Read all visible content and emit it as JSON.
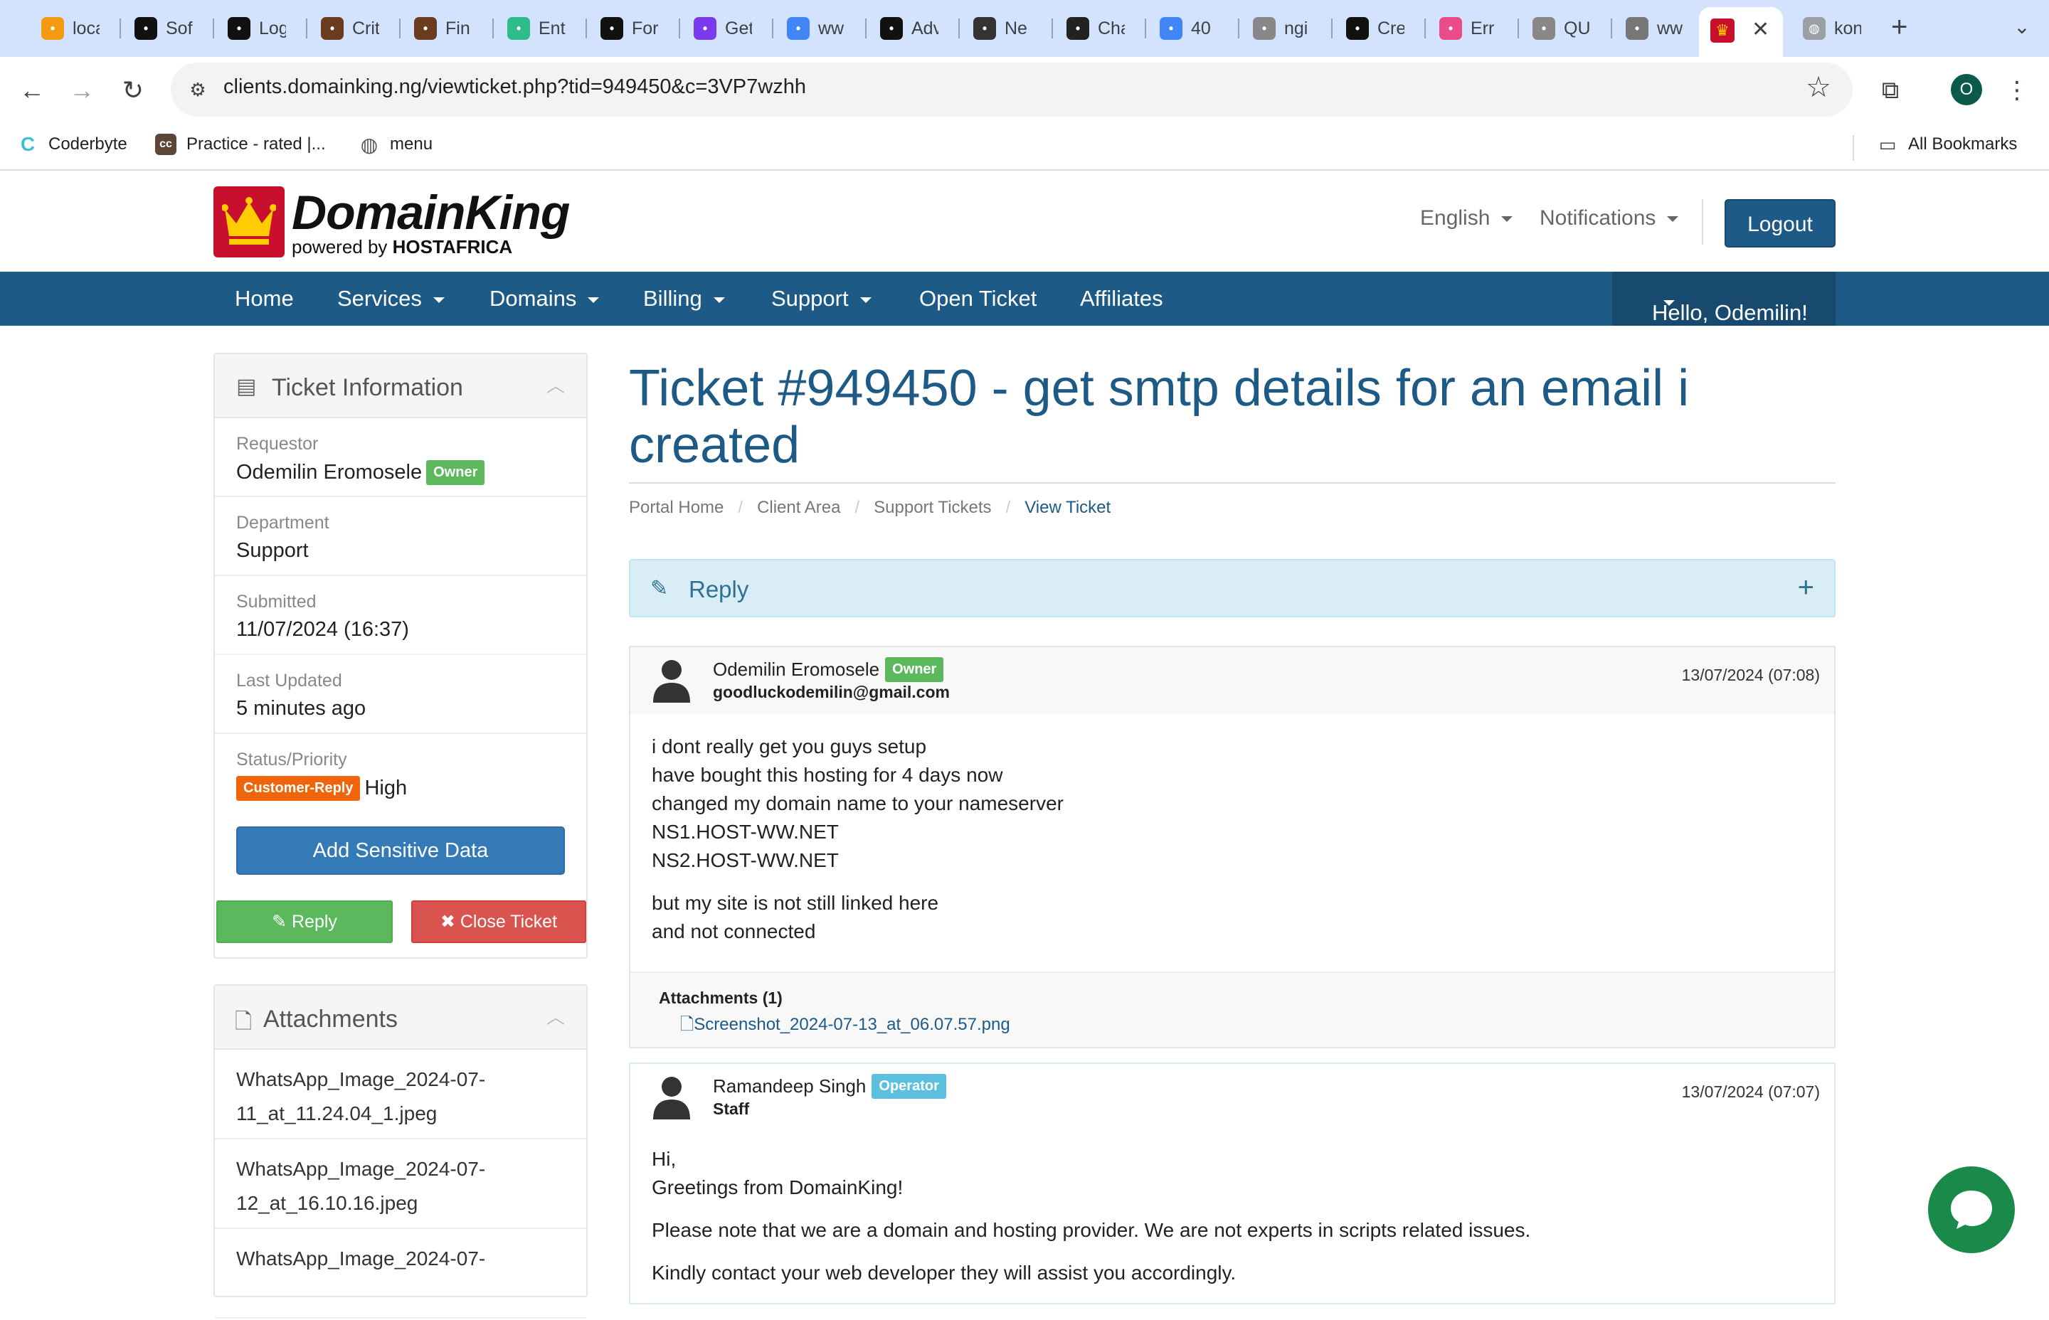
{
  "browser": {
    "tabs": [
      {
        "title": "loca",
        "icon": "pma-icon",
        "color": "#f39c12"
      },
      {
        "title": "Sof",
        "icon": "power-icon",
        "color": "#111111"
      },
      {
        "title": "Log",
        "icon": "power-icon",
        "color": "#111111"
      },
      {
        "title": "Crit",
        "icon": "book-icon",
        "color": "#6b3b1e"
      },
      {
        "title": "Fin",
        "icon": "book-icon",
        "color": "#6b3b1e"
      },
      {
        "title": "Ent",
        "icon": "vue-icon",
        "color": "#2ebc8a"
      },
      {
        "title": "For",
        "icon": "flag-icon",
        "color": "#111111"
      },
      {
        "title": "Get",
        "icon": "bootstrap-icon",
        "color": "#7c3aed"
      },
      {
        "title": "ww",
        "icon": "google-icon",
        "color": "#4285f4"
      },
      {
        "title": "Adv",
        "icon": "tv-icon",
        "color": "#111111"
      },
      {
        "title": "Ne",
        "icon": "circle-icon",
        "color": "#333333"
      },
      {
        "title": "Cha",
        "icon": "openai-icon",
        "color": "#222222"
      },
      {
        "title": "40",
        "icon": "google-icon",
        "color": "#4285f4"
      },
      {
        "title": "ngi",
        "icon": "github-icon",
        "color": "#888888"
      },
      {
        "title": "Cre",
        "icon": "ip-icon",
        "color": "#111111"
      },
      {
        "title": "Err",
        "icon": "dribbble-icon",
        "color": "#ea4c89"
      },
      {
        "title": "QU",
        "icon": "globe-icon",
        "color": "#888888"
      },
      {
        "title": "ww",
        "icon": "chart-icon",
        "color": "#777777"
      }
    ],
    "active_tab_close": "✕",
    "last_tab_title": "kon",
    "url": "clients.domainking.ng/viewticket.php?tid=949450&c=3VP7wzhh",
    "profile_initial": "O",
    "bookmarks": [
      {
        "label": "Coderbyte",
        "icon": "coderbyte-icon",
        "color": "#3ec1d3"
      },
      {
        "label": "Practice - rated |...",
        "icon": "codechef-icon",
        "color": "#5b4638"
      },
      {
        "label": "menu",
        "icon": "globe-icon",
        "color": "#555555"
      }
    ],
    "all_bookmarks": "All Bookmarks"
  },
  "header": {
    "brand": "DomainKing",
    "brand_sub_prefix": "powered by",
    "brand_sub_bold": "HOSTAFRICA",
    "language": "English",
    "notifications": "Notifications",
    "logout": "Logout",
    "brand_color": "#1d5a85"
  },
  "nav": {
    "items": [
      "Home",
      "Services",
      "Domains",
      "Billing",
      "Support",
      "Open Ticket",
      "Affiliates"
    ],
    "user": "Hello, Odemilin!"
  },
  "ticket_info": {
    "title": "Ticket Information",
    "requestor_label": "Requestor",
    "requestor": "Odemilin Eromosele",
    "requestor_badge": "Owner",
    "department_label": "Department",
    "department": "Support",
    "submitted_label": "Submitted",
    "submitted": "11/07/2024 (16:37)",
    "updated_label": "Last Updated",
    "updated": "5 minutes ago",
    "status_label": "Status/Priority",
    "status": "Customer-Reply",
    "priority": "High",
    "add_sensitive": "Add Sensitive Data",
    "reply": "Reply",
    "close_ticket": "Close Ticket"
  },
  "attachments_panel": {
    "title": "Attachments",
    "files": [
      {
        "line1": "WhatsApp_Image_2024-07-",
        "line2": "11_at_11.24.04_1.jpeg"
      },
      {
        "line1": "WhatsApp_Image_2024-07-",
        "line2": "12_at_16.10.16.jpeg"
      },
      {
        "line1": "WhatsApp_Image_2024-07-",
        "line2": ""
      }
    ]
  },
  "ticket": {
    "title": "Ticket #949450 - get smtp details for an email i created",
    "breadcrumb": [
      "Portal Home",
      "Client Area",
      "Support Tickets",
      "View Ticket"
    ],
    "reply_label": "Reply",
    "reply_expand": "+"
  },
  "messages": [
    {
      "name": "Odemilin Eromosele",
      "badge": "Owner",
      "sub": "goodluckodemilin@gmail.com",
      "date": "13/07/2024 (07:08)",
      "paragraphs": [
        [
          "i dont really get you guys setup",
          "have bought this hosting for 4 days now",
          "changed my domain name to your nameserver",
          "NS1.HOST-WW.NET",
          "NS2.HOST-WW.NET"
        ],
        [
          "but my site is not still linked here",
          "and not connected"
        ]
      ],
      "attachments_title": "Attachments (1)",
      "attachment": "Screenshot_2024-07-13_at_06.07.57.png"
    },
    {
      "name": "Ramandeep Singh",
      "badge": "Operator",
      "sub": "Staff",
      "date": "13/07/2024 (07:07)",
      "paragraphs": [
        [
          "Hi,",
          "Greetings from DomainKing!"
        ],
        [
          "Please note that we are a domain and hosting provider. We are not experts in scripts related issues."
        ],
        [
          "Kindly contact your web developer they will assist you accordingly."
        ]
      ]
    }
  ]
}
